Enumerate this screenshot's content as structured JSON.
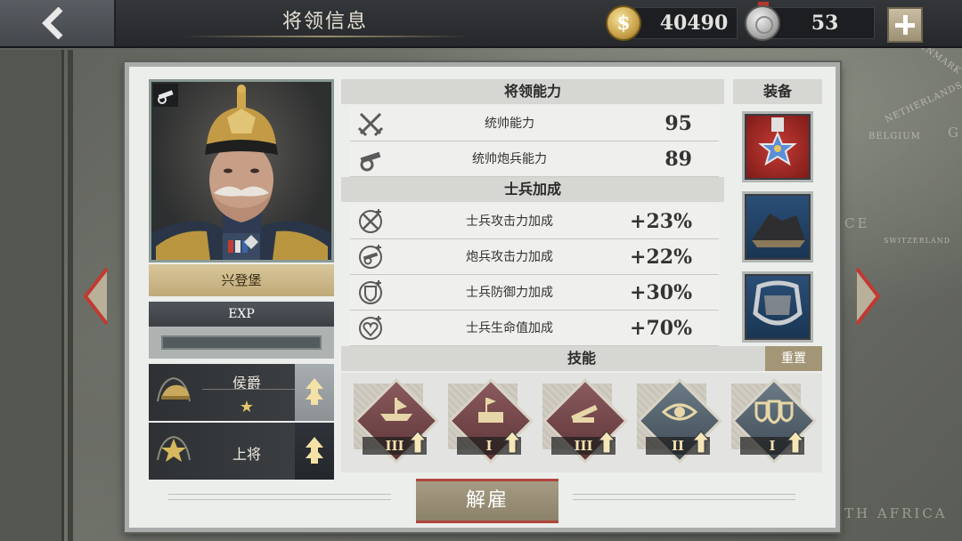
{
  "header": {
    "title": "将领信息",
    "gold_amount": "40490",
    "gold_symbol": "$",
    "medal_amount": "53"
  },
  "map": {
    "labels": [
      "DENMARK",
      "NETHERLANDS",
      "BELGIUM",
      "SWITZERLAND",
      "CE",
      "TH AFRICA",
      "G"
    ]
  },
  "general": {
    "name": "兴登堡",
    "type_icon": "artillery-icon",
    "exp_label": "EXP",
    "exp_progress": 0,
    "title_rank": "侯爵",
    "title_stars": "★",
    "military_rank": "上将"
  },
  "stats": {
    "ability_header": "将领能力",
    "abilities": [
      {
        "name": "统帅能力",
        "value": "95",
        "icon": "crossed-swords-icon"
      },
      {
        "name": "统帅炮兵能力",
        "value": "89",
        "icon": "cannon-icon"
      }
    ],
    "bonus_header": "士兵加成",
    "bonuses": [
      {
        "name": "士兵攻击力加成",
        "value": "+23%",
        "icon": "sword-plus-icon"
      },
      {
        "name": "炮兵攻击力加成",
        "value": "+22%",
        "icon": "cannon-plus-icon"
      },
      {
        "name": "士兵防御力加成",
        "value": "+30%",
        "icon": "shield-plus-icon"
      },
      {
        "name": "士兵生命值加成",
        "value": "+70%",
        "icon": "heart-plus-icon"
      }
    ]
  },
  "equipment": {
    "header": "装备",
    "slots": [
      "medal-icon",
      "ore-icon",
      "armor-icon"
    ]
  },
  "skills": {
    "header": "技能",
    "reset_label": "重置",
    "items": [
      {
        "icon": "ships-icon",
        "level": "III",
        "color": "red"
      },
      {
        "icon": "fortress-icon",
        "level": "I",
        "color": "red"
      },
      {
        "icon": "artillery-icon",
        "level": "III",
        "color": "red"
      },
      {
        "icon": "eye-icon",
        "level": "II",
        "color": "blue"
      },
      {
        "icon": "shields-icon",
        "level": "I",
        "color": "blue"
      }
    ]
  },
  "actions": {
    "dismiss_label": "解雇"
  },
  "colors": {
    "accent_red": "#b0453b",
    "gold_plate": "#d8c79c"
  }
}
